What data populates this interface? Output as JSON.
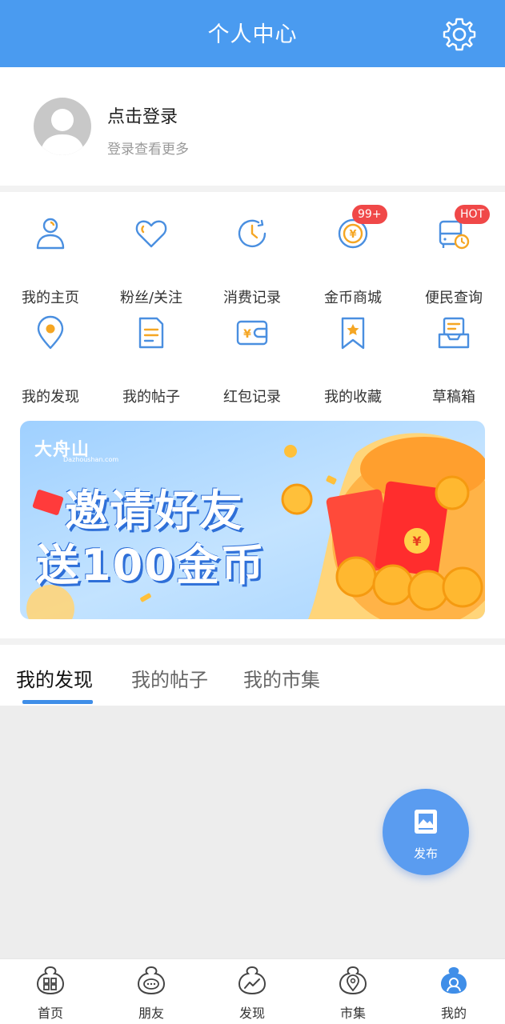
{
  "header": {
    "title": "个人中心",
    "settings_icon": "gear-icon"
  },
  "profile": {
    "title": "点击登录",
    "subtitle": "登录查看更多",
    "avatar_icon": "default-avatar-icon"
  },
  "grid": {
    "items": [
      {
        "label": "我的主页",
        "icon": "person-icon"
      },
      {
        "label": "粉丝/关注",
        "icon": "heart-icon"
      },
      {
        "label": "消费记录",
        "icon": "clock-icon"
      },
      {
        "label": "金币商城",
        "icon": "coin-icon",
        "badge": "99+"
      },
      {
        "label": "便民查询",
        "icon": "bus-icon",
        "badge": "HOT"
      },
      {
        "label": "我的发现",
        "icon": "location-pin-icon"
      },
      {
        "label": "我的帖子",
        "icon": "document-icon"
      },
      {
        "label": "红包记录",
        "icon": "wallet-icon"
      },
      {
        "label": "我的收藏",
        "icon": "bookmark-star-icon"
      },
      {
        "label": "草稿箱",
        "icon": "inbox-tray-icon"
      }
    ]
  },
  "banner": {
    "logo": "大舟山",
    "logo_sub": "Dazhoushan.com",
    "line1": "邀请好友",
    "line2": "送100金币"
  },
  "tabs": [
    {
      "label": "我的发现",
      "active": true
    },
    {
      "label": "我的帖子",
      "active": false
    },
    {
      "label": "我的市集",
      "active": false
    }
  ],
  "fab": {
    "label": "发布",
    "icon": "image-post-icon"
  },
  "nav": {
    "items": [
      {
        "label": "首页",
        "icon": "home-grid-icon"
      },
      {
        "label": "朋友",
        "icon": "chat-bubble-icon"
      },
      {
        "label": "发现",
        "icon": "trend-icon"
      },
      {
        "label": "市集",
        "icon": "map-pin-icon"
      },
      {
        "label": "我的",
        "icon": "profile-icon",
        "active": true
      }
    ]
  },
  "colors": {
    "primary": "#4a9bf0",
    "badge": "#f04848",
    "icon_blue": "#4a8fe0",
    "icon_orange": "#f5a623"
  }
}
